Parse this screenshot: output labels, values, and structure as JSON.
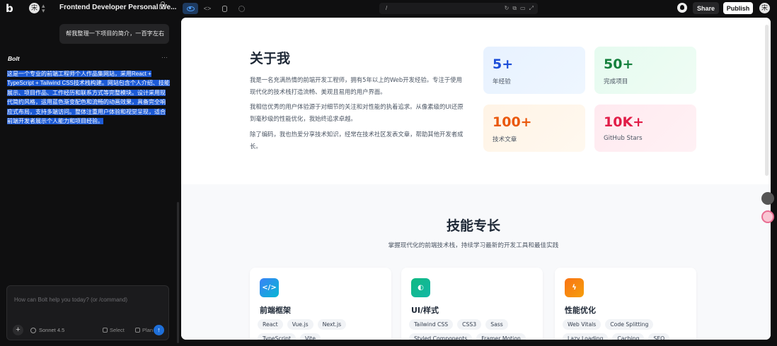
{
  "topbar": {
    "logo": "b",
    "user_initial": "宋",
    "project_title": "Frontend Developer Personal We...",
    "url": "/",
    "share_label": "Share",
    "publish_label": "Publish",
    "avatar_initial": "宋"
  },
  "chat": {
    "user_message": "帮我整理一下项目的简介，一百字左右",
    "assistant_name": "Bolt",
    "more": "···",
    "reply": "这是一个专业的前端工程师个人作品集网站，采用React + TypeScript + Tailwind CSS技术栈构建。网站包含个人介绍、技能展示、项目作品、工作经历和联系方式等完整模块。设计采用现代简约风格，运用蓝色渐变配色和流畅的动画效果，具备完全响应式布局，支持多端访问。整体注重用户体验和视觉呈现，适合前端开发者展示个人能力和项目经验。",
    "input_placeholder": "How can Bolt help you today? (or /command)",
    "model": "Sonnet 4.5",
    "select_label": "Select",
    "plan_label": "Plan",
    "plus": "+",
    "send": "↑"
  },
  "preview": {
    "about": {
      "title": "关于我",
      "paragraphs": [
        "我是一名充满热情的前端开发工程师，拥有5年以上的Web开发经验。专注于使用现代化的技术栈打造流畅、美观且易用的用户界面。",
        "我相信优秀的用户体验源于对细节的关注和对性能的执着追求。从像素级的UI还原到毫秒级的性能优化，我始终追求卓越。",
        "除了编码，我也热爱分享技术知识，经常在技术社区发表文章，帮助其他开发者成长。"
      ],
      "stats": [
        {
          "value": "5+",
          "label": "年经验"
        },
        {
          "value": "50+",
          "label": "完成项目"
        },
        {
          "value": "100+",
          "label": "技术文章"
        },
        {
          "value": "10K+",
          "label": "GitHub Stars"
        }
      ]
    },
    "skills": {
      "title": "技能专长",
      "subtitle": "掌握现代化的前端技术栈，持续学习最新的开发工具和最佳实践",
      "cards": [
        {
          "icon": "</>",
          "title": "前端框架",
          "tags": [
            "React",
            "Vue.js",
            "Next.js",
            "TypeScript",
            "Vite"
          ]
        },
        {
          "icon": "◐",
          "title": "UI/样式",
          "tags": [
            "Tailwind CSS",
            "CSS3",
            "Sass",
            "Styled Components",
            "Framer Motion"
          ]
        },
        {
          "icon": "ϟ",
          "title": "性能优化",
          "tags": [
            "Web Vitals",
            "Code Splitting",
            "Lazy Loading",
            "Caching",
            "SEO"
          ]
        }
      ]
    }
  }
}
